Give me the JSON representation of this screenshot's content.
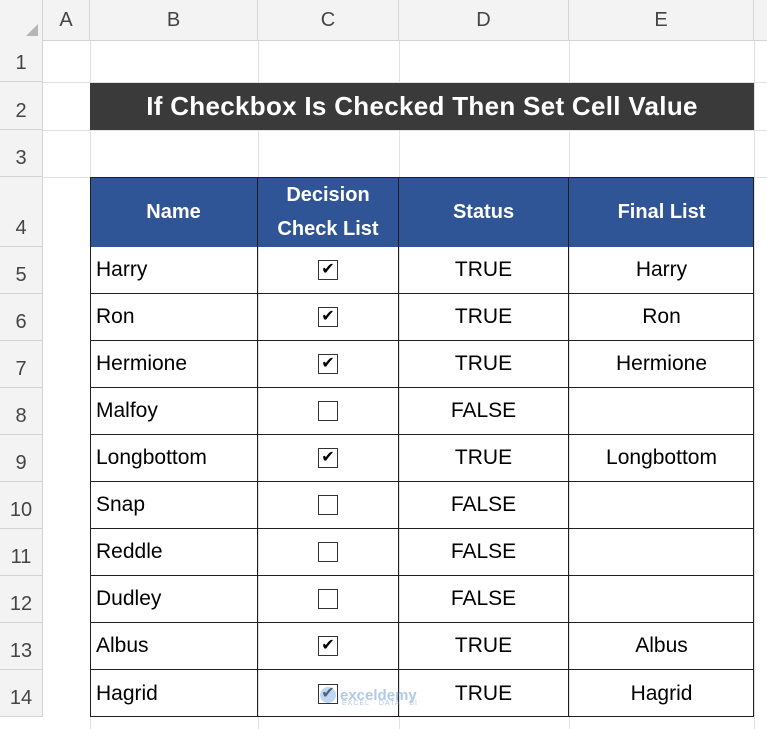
{
  "columns": [
    "A",
    "B",
    "C",
    "D",
    "E"
  ],
  "rows": [
    "1",
    "2",
    "3",
    "4",
    "5",
    "6",
    "7",
    "8",
    "9",
    "10",
    "11",
    "12",
    "13",
    "14"
  ],
  "title": "If Checkbox Is Checked Then Set Cell Value",
  "table": {
    "headers": {
      "name": "Name",
      "decision_line1": "Decision",
      "decision_line2": "Check List",
      "status": "Status",
      "final": "Final List"
    },
    "rows": [
      {
        "name": "Harry",
        "checked": true,
        "status": "TRUE",
        "final": "Harry"
      },
      {
        "name": "Ron",
        "checked": true,
        "status": "TRUE",
        "final": "Ron"
      },
      {
        "name": "Hermione",
        "checked": true,
        "status": "TRUE",
        "final": "Hermione"
      },
      {
        "name": "Malfoy",
        "checked": false,
        "status": "FALSE",
        "final": ""
      },
      {
        "name": "Longbottom",
        "checked": true,
        "status": "TRUE",
        "final": "Longbottom"
      },
      {
        "name": "Snap",
        "checked": false,
        "status": "FALSE",
        "final": ""
      },
      {
        "name": "Reddle",
        "checked": false,
        "status": "FALSE",
        "final": ""
      },
      {
        "name": "Dudley",
        "checked": false,
        "status": "FALSE",
        "final": ""
      },
      {
        "name": "Albus",
        "checked": true,
        "status": "TRUE",
        "final": "Albus"
      },
      {
        "name": "Hagrid",
        "checked": true,
        "status": "TRUE",
        "final": "Hagrid"
      }
    ]
  },
  "watermark": {
    "brand": "exceldemy",
    "tagline": "EXCEL · DATA · BI"
  },
  "colors": {
    "title_bg": "#3a3a3a",
    "header_bg": "#2f5597",
    "header_text": "#ffffff"
  }
}
